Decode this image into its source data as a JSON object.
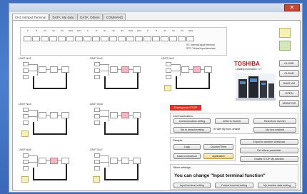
{
  "window": {
    "close_label": "✕"
  },
  "tabs": [
    {
      "label": "CH1 In/Input Terminal",
      "active": true
    },
    {
      "label": "DATA: My data",
      "active": false
    },
    {
      "label": "DATA: Others",
      "active": false
    },
    {
      "label": "COMMAND",
      "active": false
    }
  ],
  "status": {
    "bit_labels": [
      "F",
      "R",
      "S1",
      "S2",
      "S3",
      "RES",
      "EXT",
      "F",
      "R",
      "S1",
      "S2",
      "S3",
      "RES",
      "EXT",
      "F",
      "R",
      "S1",
      "S2",
      "S3",
      "RES"
    ],
    "legend": [
      "ST: Internal input terminal",
      "STF: Virtual input terminal"
    ]
  },
  "units": [
    {
      "label": "UNIT No1"
    },
    {
      "label": "UNIT No2"
    },
    {
      "label": "UNIT No3"
    },
    {
      "label": "UNIT No4"
    },
    {
      "label": "UNIT No5"
    },
    {
      "label": "UNIT No6"
    },
    {
      "label": "UNIT No7"
    },
    {
      "label": "UNIT No8"
    }
  ],
  "brand": {
    "logo": "TOSHIBA",
    "tagline": "Leading Innovation >>>"
  },
  "side_buttons": [
    "CLOSE",
    "CLEAR",
    "SAVE AS",
    "OPEN",
    "MONITOR"
  ],
  "emergency": "Emergency STOP",
  "communication": {
    "title": "Communication",
    "buttons": [
      "Communication setting",
      "Write to Inverter",
      "Read from Inverter",
      "Set to default setting",
      "My func enabled"
    ],
    "checkbox": "w/ with My func. enable"
  },
  "sample": {
    "title": "Sample",
    "buttons": [
      "Logic",
      "Counter/Timer",
      "Data Comparison",
      "Application"
    ]
  },
  "export": {
    "buttons": [
      "Export to another Workbook",
      "Get others parameter",
      "Enable STOP My function"
    ]
  },
  "other": {
    "title": "Other settings",
    "heading": "You can change \"Input terminal function\"",
    "buttons": [
      "Input terminal setting",
      "Output terminal setting",
      "My function data setting"
    ]
  },
  "colors": {
    "estop": "#e0302a",
    "logo": "#d0101a",
    "pink": "#f4b6c2",
    "yellow": "#f6f0b8",
    "green": "#d3e8b6"
  }
}
